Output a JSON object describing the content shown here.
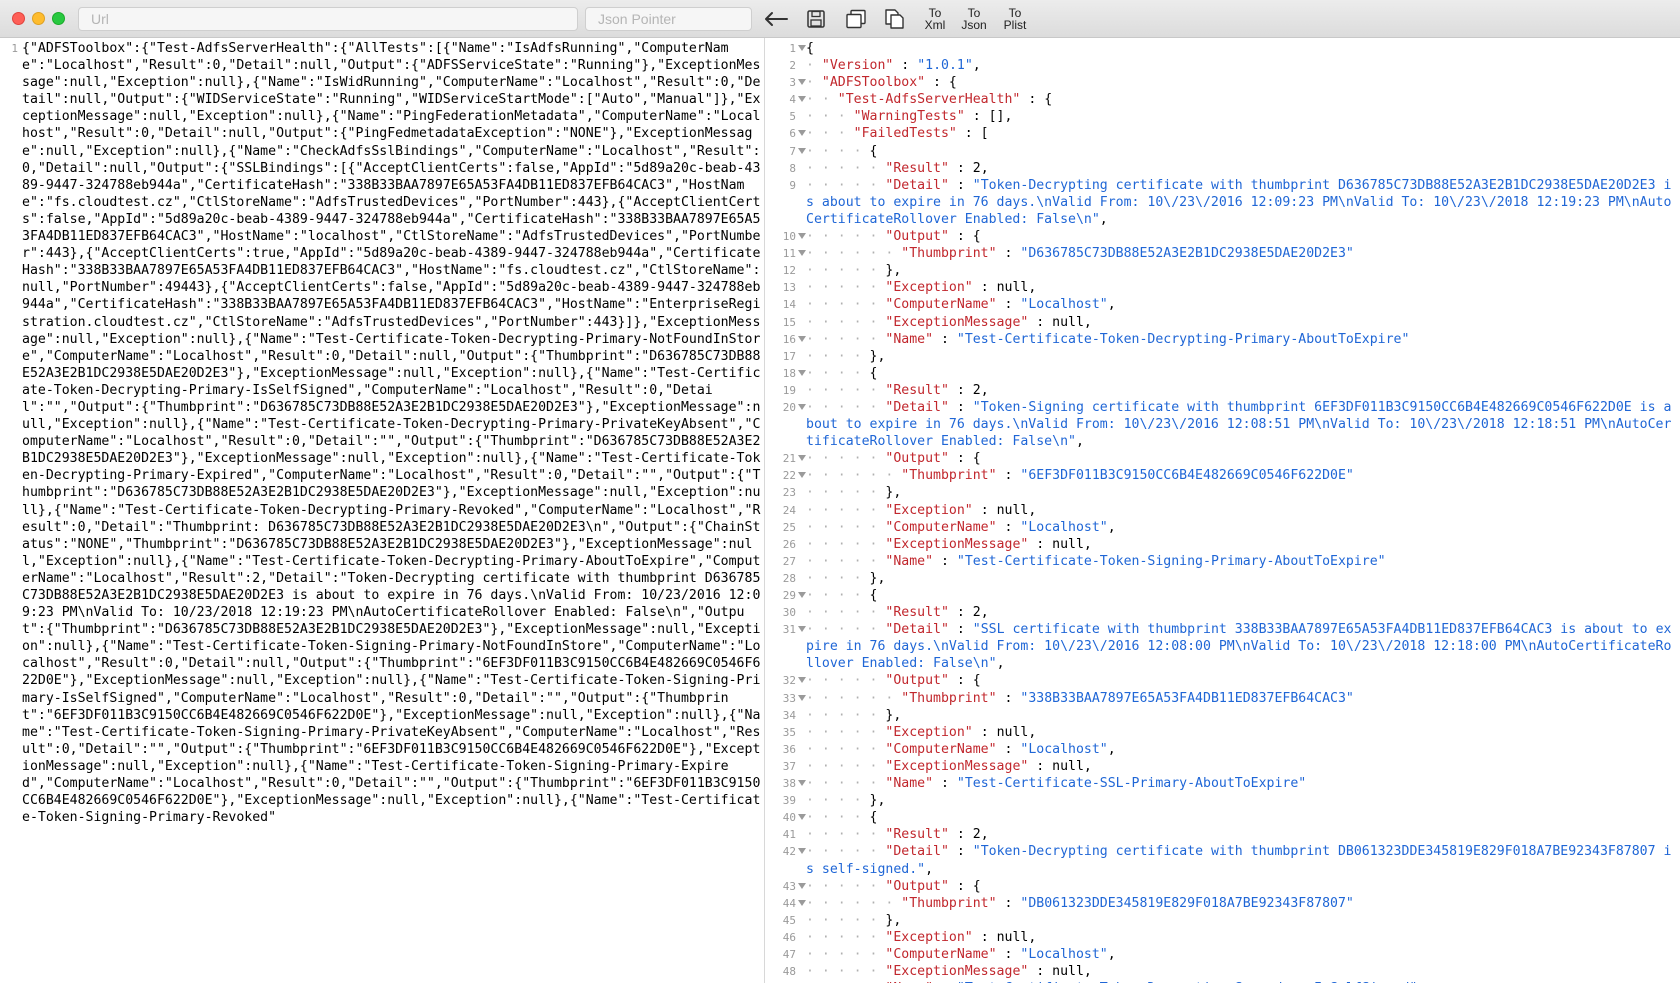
{
  "toolbar": {
    "url_placeholder": "Url",
    "url_value": "",
    "pointer_placeholder": "Json Pointer",
    "pointer_value": "",
    "to_xml_label": "To\nXml",
    "to_json_label": "To\nJson",
    "to_plist_label": "To\nPlist",
    "icons": [
      "back-arrow-icon",
      "save-icon",
      "copy-icon",
      "paste-icon"
    ]
  },
  "raw_pane": {
    "line_number": "1",
    "text": "{\"ADFSToolbox\":{\"Test-AdfsServerHealth\":{\"AllTests\":[{\"Name\":\"IsAdfsRunning\",\"ComputerName\":\"Localhost\",\"Result\":0,\"Detail\":null,\"Output\":{\"ADFSServiceState\":\"Running\"},\"ExceptionMessage\":null,\"Exception\":null},{\"Name\":\"IsWidRunning\",\"ComputerName\":\"Localhost\",\"Result\":0,\"Detail\":null,\"Output\":{\"WIDServiceState\":\"Running\",\"WIDServiceStartMode\":[\"Auto\",\"Manual\"]},\"ExceptionMessage\":null,\"Exception\":null},{\"Name\":\"PingFederationMetadata\",\"ComputerName\":\"Localhost\",\"Result\":0,\"Detail\":null,\"Output\":{\"PingFedmetadataException\":\"NONE\"},\"ExceptionMessage\":null,\"Exception\":null},{\"Name\":\"CheckAdfsSslBindings\",\"ComputerName\":\"Localhost\",\"Result\":0,\"Detail\":null,\"Output\":{\"SSLBindings\":[{\"AcceptClientCerts\":false,\"AppId\":\"5d89a20c-beab-4389-9447-324788eb944a\",\"CertificateHash\":\"338B33BAA7897E65A53FA4DB11ED837EFB64CAC3\",\"HostName\":\"fs.cloudtest.cz\",\"CtlStoreName\":\"AdfsTrustedDevices\",\"PortNumber\":443},{\"AcceptClientCerts\":false,\"AppId\":\"5d89a20c-beab-4389-9447-324788eb944a\",\"CertificateHash\":\"338B33BAA7897E65A53FA4DB11ED837EFB64CAC3\",\"HostName\":\"localhost\",\"CtlStoreName\":\"AdfsTrustedDevices\",\"PortNumber\":443},{\"AcceptClientCerts\":true,\"AppId\":\"5d89a20c-beab-4389-9447-324788eb944a\",\"CertificateHash\":\"338B33BAA7897E65A53FA4DB11ED837EFB64CAC3\",\"HostName\":\"fs.cloudtest.cz\",\"CtlStoreName\":null,\"PortNumber\":49443},{\"AcceptClientCerts\":false,\"AppId\":\"5d89a20c-beab-4389-9447-324788eb944a\",\"CertificateHash\":\"338B33BAA7897E65A53FA4DB11ED837EFB64CAC3\",\"HostName\":\"EnterpriseRegistration.cloudtest.cz\",\"CtlStoreName\":\"AdfsTrustedDevices\",\"PortNumber\":443}]},\"ExceptionMessage\":null,\"Exception\":null},{\"Name\":\"Test-Certificate-Token-Decrypting-Primary-NotFoundInStore\",\"ComputerName\":\"Localhost\",\"Result\":0,\"Detail\":null,\"Output\":{\"Thumbprint\":\"D636785C73DB88E52A3E2B1DC2938E5DAE20D2E3\"},\"ExceptionMessage\":null,\"Exception\":null},{\"Name\":\"Test-Certificate-Token-Decrypting-Primary-IsSelfSigned\",\"ComputerName\":\"Localhost\",\"Result\":0,\"Detail\":\"\",\"Output\":{\"Thumbprint\":\"D636785C73DB88E52A3E2B1DC2938E5DAE20D2E3\"},\"ExceptionMessage\":null,\"Exception\":null},{\"Name\":\"Test-Certificate-Token-Decrypting-Primary-PrivateKeyAbsent\",\"ComputerName\":\"Localhost\",\"Result\":0,\"Detail\":\"\",\"Output\":{\"Thumbprint\":\"D636785C73DB88E52A3E2B1DC2938E5DAE20D2E3\"},\"ExceptionMessage\":null,\"Exception\":null},{\"Name\":\"Test-Certificate-Token-Decrypting-Primary-Expired\",\"ComputerName\":\"Localhost\",\"Result\":0,\"Detail\":\"\",\"Output\":{\"Thumbprint\":\"D636785C73DB88E52A3E2B1DC2938E5DAE20D2E3\"},\"ExceptionMessage\":null,\"Exception\":null},{\"Name\":\"Test-Certificate-Token-Decrypting-Primary-Revoked\",\"ComputerName\":\"Localhost\",\"Result\":0,\"Detail\":\"Thumbprint: D636785C73DB88E52A3E2B1DC2938E5DAE20D2E3\\n\",\"Output\":{\"ChainStatus\":\"NONE\",\"Thumbprint\":\"D636785C73DB88E52A3E2B1DC2938E5DAE20D2E3\"},\"ExceptionMessage\":null,\"Exception\":null},{\"Name\":\"Test-Certificate-Token-Decrypting-Primary-AboutToExpire\",\"ComputerName\":\"Localhost\",\"Result\":2,\"Detail\":\"Token-Decrypting certificate with thumbprint D636785C73DB88E52A3E2B1DC2938E5DAE20D2E3 is about to expire in 76 days.\\nValid From: 10/23/2016 12:09:23 PM\\nValid To: 10/23/2018 12:19:23 PM\\nAutoCertificateRollover Enabled: False\\n\",\"Output\":{\"Thumbprint\":\"D636785C73DB88E52A3E2B1DC2938E5DAE20D2E3\"},\"ExceptionMessage\":null,\"Exception\":null},{\"Name\":\"Test-Certificate-Token-Signing-Primary-NotFoundInStore\",\"ComputerName\":\"Localhost\",\"Result\":0,\"Detail\":null,\"Output\":{\"Thumbprint\":\"6EF3DF011B3C9150CC6B4E482669C0546F622D0E\"},\"ExceptionMessage\":null,\"Exception\":null},{\"Name\":\"Test-Certificate-Token-Signing-Primary-IsSelfSigned\",\"ComputerName\":\"Localhost\",\"Result\":0,\"Detail\":\"\",\"Output\":{\"Thumbprint\":\"6EF3DF011B3C9150CC6B4E482669C0546F622D0E\"},\"ExceptionMessage\":null,\"Exception\":null},{\"Name\":\"Test-Certificate-Token-Signing-Primary-PrivateKeyAbsent\",\"ComputerName\":\"Localhost\",\"Result\":0,\"Detail\":\"\",\"Output\":{\"Thumbprint\":\"6EF3DF011B3C9150CC6B4E482669C0546F622D0E\"},\"ExceptionMessage\":null,\"Exception\":null},{\"Name\":\"Test-Certificate-Token-Signing-Primary-Expired\",\"ComputerName\":\"Localhost\",\"Result\":0,\"Detail\":\"\",\"Output\":{\"Thumbprint\":\"6EF3DF011B3C9150CC6B4E482669C0546F622D0E\"},\"ExceptionMessage\":null,\"Exception\":null},{\"Name\":\"Test-Certificate-Token-Signing-Primary-Revoked\""
  },
  "pretty_pane": {
    "lines": [
      {
        "n": "1",
        "fold": true,
        "d": 0,
        "t": [
          [
            "p",
            "{"
          ]
        ]
      },
      {
        "n": "2",
        "fold": false,
        "d": 1,
        "t": [
          [
            "k",
            "\"Version\""
          ],
          [
            "p",
            " : "
          ],
          [
            "s",
            "\"1.0.1\""
          ],
          [
            "p",
            ","
          ]
        ]
      },
      {
        "n": "3",
        "fold": true,
        "d": 1,
        "t": [
          [
            "k",
            "\"ADFSToolbox\""
          ],
          [
            "p",
            " : {"
          ]
        ]
      },
      {
        "n": "4",
        "fold": true,
        "d": 2,
        "t": [
          [
            "k",
            "\"Test-AdfsServerHealth\""
          ],
          [
            "p",
            " : {"
          ]
        ]
      },
      {
        "n": "5",
        "fold": false,
        "d": 3,
        "t": [
          [
            "k",
            "\"WarningTests\""
          ],
          [
            "p",
            " : [],"
          ]
        ]
      },
      {
        "n": "6",
        "fold": true,
        "d": 3,
        "t": [
          [
            "k",
            "\"FailedTests\""
          ],
          [
            "p",
            " : ["
          ]
        ]
      },
      {
        "n": "7",
        "fold": true,
        "d": 4,
        "t": [
          [
            "p",
            "{"
          ]
        ]
      },
      {
        "n": "8",
        "fold": false,
        "d": 5,
        "t": [
          [
            "k",
            "\"Result\""
          ],
          [
            "p",
            " : "
          ],
          [
            "n",
            "2"
          ],
          [
            "p",
            ","
          ]
        ]
      },
      {
        "n": "9",
        "fold": false,
        "d": 5,
        "t": [
          [
            "k",
            "\"Detail\""
          ],
          [
            "p",
            " : "
          ],
          [
            "s",
            "\"Token-Decrypting certificate with thumbprint D636785C73DB88E52A3E2B1DC2938E5DAE20D2E3 is about to expire in 76 days.\\nValid From: 10\\/23\\/2016 12:09:23 PM\\nValid To: 10\\/23\\/2018 12:19:23 PM\\nAutoCertificateRollover Enabled: False\\n\""
          ],
          [
            "p",
            ","
          ]
        ]
      },
      {
        "n": "10",
        "fold": true,
        "d": 5,
        "t": [
          [
            "k",
            "\"Output\""
          ],
          [
            "p",
            " : {"
          ]
        ]
      },
      {
        "n": "11",
        "fold": true,
        "d": 6,
        "t": [
          [
            "k",
            "\"Thumbprint\""
          ],
          [
            "p",
            " : "
          ],
          [
            "s",
            "\"D636785C73DB88E52A3E2B1DC2938E5DAE20D2E3\""
          ]
        ]
      },
      {
        "n": "12",
        "fold": false,
        "d": 5,
        "t": [
          [
            "p",
            "},"
          ]
        ]
      },
      {
        "n": "13",
        "fold": false,
        "d": 5,
        "t": [
          [
            "k",
            "\"Exception\""
          ],
          [
            "p",
            " : "
          ],
          [
            "n",
            "null"
          ],
          [
            "p",
            ","
          ]
        ]
      },
      {
        "n": "14",
        "fold": false,
        "d": 5,
        "t": [
          [
            "k",
            "\"ComputerName\""
          ],
          [
            "p",
            " : "
          ],
          [
            "s",
            "\"Localhost\""
          ],
          [
            "p",
            ","
          ]
        ]
      },
      {
        "n": "15",
        "fold": false,
        "d": 5,
        "t": [
          [
            "k",
            "\"ExceptionMessage\""
          ],
          [
            "p",
            " : "
          ],
          [
            "n",
            "null"
          ],
          [
            "p",
            ","
          ]
        ]
      },
      {
        "n": "16",
        "fold": true,
        "d": 5,
        "t": [
          [
            "k",
            "\"Name\""
          ],
          [
            "p",
            " : "
          ],
          [
            "s",
            "\"Test-Certificate-Token-Decrypting-Primary-AboutToExpire\""
          ]
        ]
      },
      {
        "n": "17",
        "fold": false,
        "d": 4,
        "t": [
          [
            "p",
            "},"
          ]
        ]
      },
      {
        "n": "18",
        "fold": true,
        "d": 4,
        "t": [
          [
            "p",
            "{"
          ]
        ]
      },
      {
        "n": "19",
        "fold": false,
        "d": 5,
        "t": [
          [
            "k",
            "\"Result\""
          ],
          [
            "p",
            " : "
          ],
          [
            "n",
            "2"
          ],
          [
            "p",
            ","
          ]
        ]
      },
      {
        "n": "20",
        "fold": true,
        "d": 5,
        "t": [
          [
            "k",
            "\"Detail\""
          ],
          [
            "p",
            " : "
          ],
          [
            "s",
            "\"Token-Signing certificate with thumbprint 6EF3DF011B3C9150CC6B4E482669C0546F622D0E is about to expire in 76 days.\\nValid From: 10\\/23\\/2016 12:08:51 PM\\nValid To: 10\\/23\\/2018 12:18:51 PM\\nAutoCertificateRollover Enabled: False\\n\""
          ],
          [
            "p",
            ","
          ]
        ]
      },
      {
        "n": "21",
        "fold": true,
        "d": 5,
        "t": [
          [
            "k",
            "\"Output\""
          ],
          [
            "p",
            " : {"
          ]
        ]
      },
      {
        "n": "22",
        "fold": true,
        "d": 6,
        "t": [
          [
            "k",
            "\"Thumbprint\""
          ],
          [
            "p",
            " : "
          ],
          [
            "s",
            "\"6EF3DF011B3C9150CC6B4E482669C0546F622D0E\""
          ]
        ]
      },
      {
        "n": "23",
        "fold": false,
        "d": 5,
        "t": [
          [
            "p",
            "},"
          ]
        ]
      },
      {
        "n": "24",
        "fold": false,
        "d": 5,
        "t": [
          [
            "k",
            "\"Exception\""
          ],
          [
            "p",
            " : "
          ],
          [
            "n",
            "null"
          ],
          [
            "p",
            ","
          ]
        ]
      },
      {
        "n": "25",
        "fold": false,
        "d": 5,
        "t": [
          [
            "k",
            "\"ComputerName\""
          ],
          [
            "p",
            " : "
          ],
          [
            "s",
            "\"Localhost\""
          ],
          [
            "p",
            ","
          ]
        ]
      },
      {
        "n": "26",
        "fold": false,
        "d": 5,
        "t": [
          [
            "k",
            "\"ExceptionMessage\""
          ],
          [
            "p",
            " : "
          ],
          [
            "n",
            "null"
          ],
          [
            "p",
            ","
          ]
        ]
      },
      {
        "n": "27",
        "fold": false,
        "d": 5,
        "t": [
          [
            "k",
            "\"Name\""
          ],
          [
            "p",
            " : "
          ],
          [
            "s",
            "\"Test-Certificate-Token-Signing-Primary-AboutToExpire\""
          ]
        ]
      },
      {
        "n": "28",
        "fold": false,
        "d": 4,
        "t": [
          [
            "p",
            "},"
          ]
        ]
      },
      {
        "n": "29",
        "fold": true,
        "d": 4,
        "t": [
          [
            "p",
            "{"
          ]
        ]
      },
      {
        "n": "30",
        "fold": false,
        "d": 5,
        "t": [
          [
            "k",
            "\"Result\""
          ],
          [
            "p",
            " : "
          ],
          [
            "n",
            "2"
          ],
          [
            "p",
            ","
          ]
        ]
      },
      {
        "n": "31",
        "fold": true,
        "d": 5,
        "t": [
          [
            "k",
            "\"Detail\""
          ],
          [
            "p",
            " : "
          ],
          [
            "s",
            "\"SSL certificate with thumbprint 338B33BAA7897E65A53FA4DB11ED837EFB64CAC3 is about to expire in 76 days.\\nValid From: 10\\/23\\/2016 12:08:00 PM\\nValid To: 10\\/23\\/2018 12:18:00 PM\\nAutoCertificateRollover Enabled: False\\n\""
          ],
          [
            "p",
            ","
          ]
        ]
      },
      {
        "n": "32",
        "fold": true,
        "d": 5,
        "t": [
          [
            "k",
            "\"Output\""
          ],
          [
            "p",
            " : {"
          ]
        ]
      },
      {
        "n": "33",
        "fold": true,
        "d": 6,
        "t": [
          [
            "k",
            "\"Thumbprint\""
          ],
          [
            "p",
            " : "
          ],
          [
            "s",
            "\"338B33BAA7897E65A53FA4DB11ED837EFB64CAC3\""
          ]
        ]
      },
      {
        "n": "34",
        "fold": false,
        "d": 5,
        "t": [
          [
            "p",
            "},"
          ]
        ]
      },
      {
        "n": "35",
        "fold": false,
        "d": 5,
        "t": [
          [
            "k",
            "\"Exception\""
          ],
          [
            "p",
            " : "
          ],
          [
            "n",
            "null"
          ],
          [
            "p",
            ","
          ]
        ]
      },
      {
        "n": "36",
        "fold": false,
        "d": 5,
        "t": [
          [
            "k",
            "\"ComputerName\""
          ],
          [
            "p",
            " : "
          ],
          [
            "s",
            "\"Localhost\""
          ],
          [
            "p",
            ","
          ]
        ]
      },
      {
        "n": "37",
        "fold": false,
        "d": 5,
        "t": [
          [
            "k",
            "\"ExceptionMessage\""
          ],
          [
            "p",
            " : "
          ],
          [
            "n",
            "null"
          ],
          [
            "p",
            ","
          ]
        ]
      },
      {
        "n": "38",
        "fold": true,
        "d": 5,
        "t": [
          [
            "k",
            "\"Name\""
          ],
          [
            "p",
            " : "
          ],
          [
            "s",
            "\"Test-Certificate-SSL-Primary-AboutToExpire\""
          ]
        ]
      },
      {
        "n": "39",
        "fold": false,
        "d": 4,
        "t": [
          [
            "p",
            "},"
          ]
        ]
      },
      {
        "n": "40",
        "fold": true,
        "d": 4,
        "t": [
          [
            "p",
            "{"
          ]
        ]
      },
      {
        "n": "41",
        "fold": false,
        "d": 5,
        "t": [
          [
            "k",
            "\"Result\""
          ],
          [
            "p",
            " : "
          ],
          [
            "n",
            "2"
          ],
          [
            "p",
            ","
          ]
        ]
      },
      {
        "n": "42",
        "fold": true,
        "d": 5,
        "t": [
          [
            "k",
            "\"Detail\""
          ],
          [
            "p",
            " : "
          ],
          [
            "s",
            "\"Token-Decrypting certificate with thumbprint DB061323DDE345819E829F018A7BE92343F87807 is self-signed.\""
          ],
          [
            "p",
            ","
          ]
        ]
      },
      {
        "n": "43",
        "fold": true,
        "d": 5,
        "t": [
          [
            "k",
            "\"Output\""
          ],
          [
            "p",
            " : {"
          ]
        ]
      },
      {
        "n": "44",
        "fold": true,
        "d": 6,
        "t": [
          [
            "k",
            "\"Thumbprint\""
          ],
          [
            "p",
            " : "
          ],
          [
            "s",
            "\"DB061323DDE345819E829F018A7BE92343F87807\""
          ]
        ]
      },
      {
        "n": "45",
        "fold": false,
        "d": 5,
        "t": [
          [
            "p",
            "},"
          ]
        ]
      },
      {
        "n": "46",
        "fold": false,
        "d": 5,
        "t": [
          [
            "k",
            "\"Exception\""
          ],
          [
            "p",
            " : "
          ],
          [
            "n",
            "null"
          ],
          [
            "p",
            ","
          ]
        ]
      },
      {
        "n": "47",
        "fold": false,
        "d": 5,
        "t": [
          [
            "k",
            "\"ComputerName\""
          ],
          [
            "p",
            " : "
          ],
          [
            "s",
            "\"Localhost\""
          ],
          [
            "p",
            ","
          ]
        ]
      },
      {
        "n": "48",
        "fold": false,
        "d": 5,
        "t": [
          [
            "k",
            "\"ExceptionMessage\""
          ],
          [
            "p",
            " : "
          ],
          [
            "n",
            "null"
          ],
          [
            "p",
            ","
          ]
        ]
      },
      {
        "n": "49",
        "fold": false,
        "d": 5,
        "t": [
          [
            "k",
            "\"Name\""
          ],
          [
            "p",
            " : "
          ],
          [
            "s",
            "\"Test-Certificate-Token-Decrypting-Secondary-IsSelfSigned\""
          ]
        ]
      }
    ]
  },
  "colors": {
    "key": "#c1272d",
    "string": "#1f66d6",
    "gutter": "#9a9a9a",
    "indent_dots": "#b0b0b0",
    "window_close": "#fe5f57",
    "window_minimize": "#febc2e",
    "window_zoom": "#28c840"
  }
}
